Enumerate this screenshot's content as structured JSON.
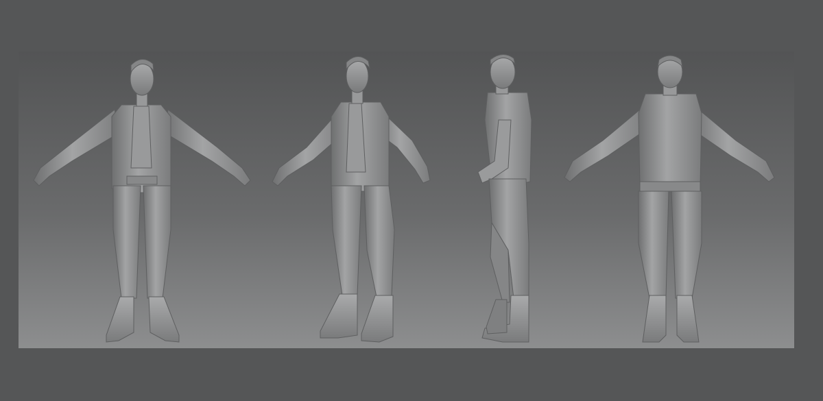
{
  "scene": {
    "description_colors": {
      "frame": "#555657",
      "viewport_top": "#535455",
      "viewport_bottom": "#8d8e8f",
      "clay": "#8e8f90",
      "clay_shadow": "#6f7071",
      "clay_highlight": "#b2b3b4"
    },
    "views": [
      {
        "name": "front-view"
      },
      {
        "name": "three-quarter-view"
      },
      {
        "name": "side-view"
      },
      {
        "name": "back-view"
      }
    ]
  }
}
